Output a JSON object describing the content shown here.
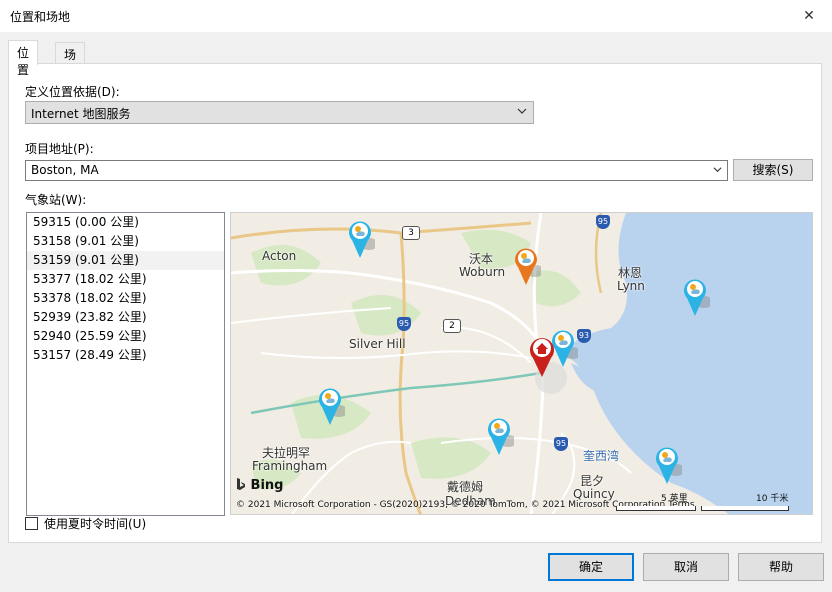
{
  "window": {
    "title": "位置和场地",
    "close_glyph": "✕"
  },
  "tabs": [
    {
      "label": "位置",
      "active": true
    },
    {
      "label": "场地",
      "active": false
    }
  ],
  "location": {
    "basis_label": "定义位置依据(D):",
    "basis_value": "Internet 地图服务",
    "address_label": "项目地址(P):",
    "address_value": "Boston, MA",
    "search_button": "搜索(S)"
  },
  "stations": {
    "label": "气象站(W):",
    "selected_index": 2,
    "items": [
      "59315 (0.00 公里)",
      "53158 (9.01 公里)",
      "53159 (9.01 公里)",
      "53377 (18.02 公里)",
      "53378 (18.02 公里)",
      "52939 (23.82 公里)",
      "52940 (25.59 公里)",
      "53157 (28.49 公里)"
    ]
  },
  "map": {
    "labels": {
      "acton": "Acton",
      "woburn_cn": "沃本",
      "woburn": "Woburn",
      "lynn_cn": "林恩",
      "lynn": "Lynn",
      "silver_hill": "Silver Hill",
      "framingham_cn": "夫拉明罕",
      "framingham": "Framingham",
      "dedham_cn": "戴德姆",
      "dedham": "Dedham",
      "quincy_cn": "昆夕",
      "quincy": "Quincy",
      "bay_cn": "奎西湾"
    },
    "shields": {
      "r3": "3",
      "r2": "2",
      "i95a": "95",
      "i95b": "95",
      "i95c": "95",
      "i93": "93"
    },
    "bing": "Bing",
    "copyright": "© 2021 Microsoft Corporation - GS(2020)2193, © 2020 TomTom, © 2021 Microsoft Corporation  Terms",
    "scale_a": "5 英里",
    "scale_b": "10 千米",
    "colors": {
      "water": "#b9d3ee",
      "land": "#f1ede4",
      "park": "#d7e8c4",
      "pin_blue": "#2bb3e6",
      "pin_orange": "#e8761e",
      "pin_home": "#c8201c"
    }
  },
  "dst": {
    "label": "使用夏时令时间(U)",
    "checked": false
  },
  "footer": {
    "ok": "确定",
    "cancel": "取消",
    "help": "帮助"
  }
}
